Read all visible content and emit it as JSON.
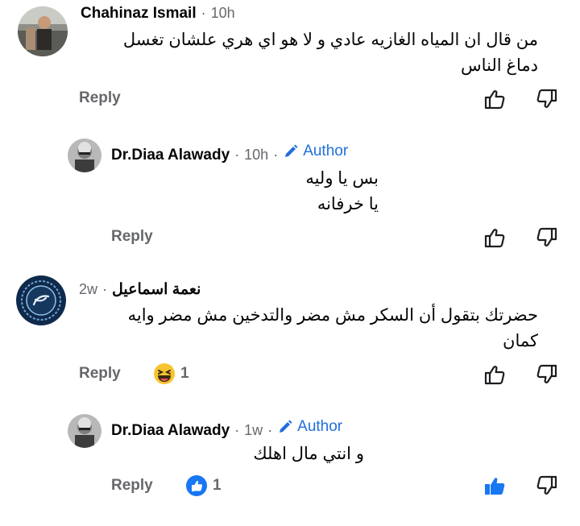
{
  "comments": [
    {
      "name": "Chahinaz Ismail",
      "time": "10h",
      "body_lines": [
        "من قال ان المياه الغازيه عادي و لا هو اي هري علشان تغسل",
        "دماغ الناس"
      ],
      "reply_label": "Reply",
      "liked": false
    },
    {
      "name": "Dr.Diaa Alawady",
      "time": "10h",
      "author_label": "Author",
      "body_lines": [
        "بس يا وليه",
        "يا خرفانه"
      ],
      "reply_label": "Reply",
      "liked": false
    },
    {
      "name": "نعمة اسماعيل",
      "time": "2w",
      "body_lines": [
        "حضرتك بتقول أن السكر مش مضر والتدخين مش مضر وايه",
        "كمان"
      ],
      "reply_label": "Reply",
      "reaction": {
        "icon": "haha-emoji-icon",
        "count": "1"
      },
      "liked": false
    },
    {
      "name": "Dr.Diaa Alawady",
      "time": "1w",
      "author_label": "Author",
      "body_lines": [
        "و انتي مال اهلك"
      ],
      "reply_label": "Reply",
      "reaction": {
        "icon": "like-reaction-icon",
        "count": "1"
      },
      "liked": true
    }
  ],
  "colors": {
    "author_blue": "#216fdb",
    "meta_gray": "#65676b",
    "like_blue": "#1877f2"
  }
}
